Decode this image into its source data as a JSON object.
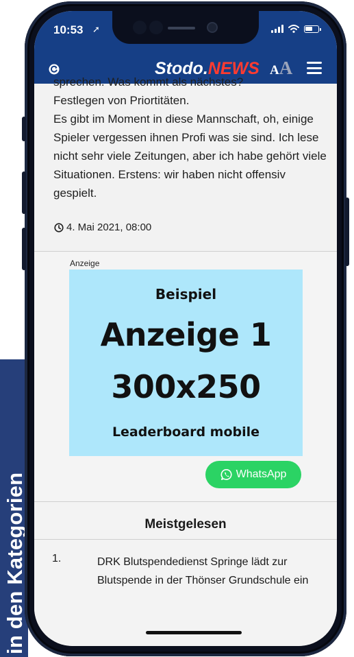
{
  "side_label": "in den Kategorien",
  "status_bar": {
    "time": "10:53",
    "location_arrow": "location-arrow-icon"
  },
  "header": {
    "logo_part1": "Stodo.",
    "logo_part2": "NEWS",
    "font_small": "A",
    "font_big": "A",
    "icons": [
      "refresh-icon",
      "font-size-icon",
      "menu-icon"
    ]
  },
  "article": {
    "cut_line": "sprechen. Was kommt als nächstes?",
    "lines": [
      "Festlegen von Priortitäten.",
      "Es gibt im Moment in diese Mannschaft, oh, einige Spieler vergessen ihnen Profi was sie sind. Ich lese nicht sehr viele Zeitungen, aber ich habe gehört viele Situationen. Erstens: wir haben nicht offensiv gespielt."
    ],
    "timestamp": "4. Mai 2021, 08:00"
  },
  "ad": {
    "label": "Anzeige",
    "line1": "Beispiel",
    "line2": "Anzeige 1",
    "line3": "300x250",
    "line4": "Leaderboard mobile",
    "bg_color": "#aee7fb"
  },
  "whatsapp": {
    "label": "WhatsApp",
    "color": "#2bd364"
  },
  "mostread": {
    "title": "Meistgelesen",
    "items": [
      {
        "num": "1.",
        "text": "DRK Blutspendedienst Springe lädt zur Blutspende in der Thönser Grundschule ein"
      }
    ]
  },
  "colors": {
    "header_blue": "#163f86",
    "news_red": "#ff3b30",
    "strip_blue": "#263f7a"
  }
}
